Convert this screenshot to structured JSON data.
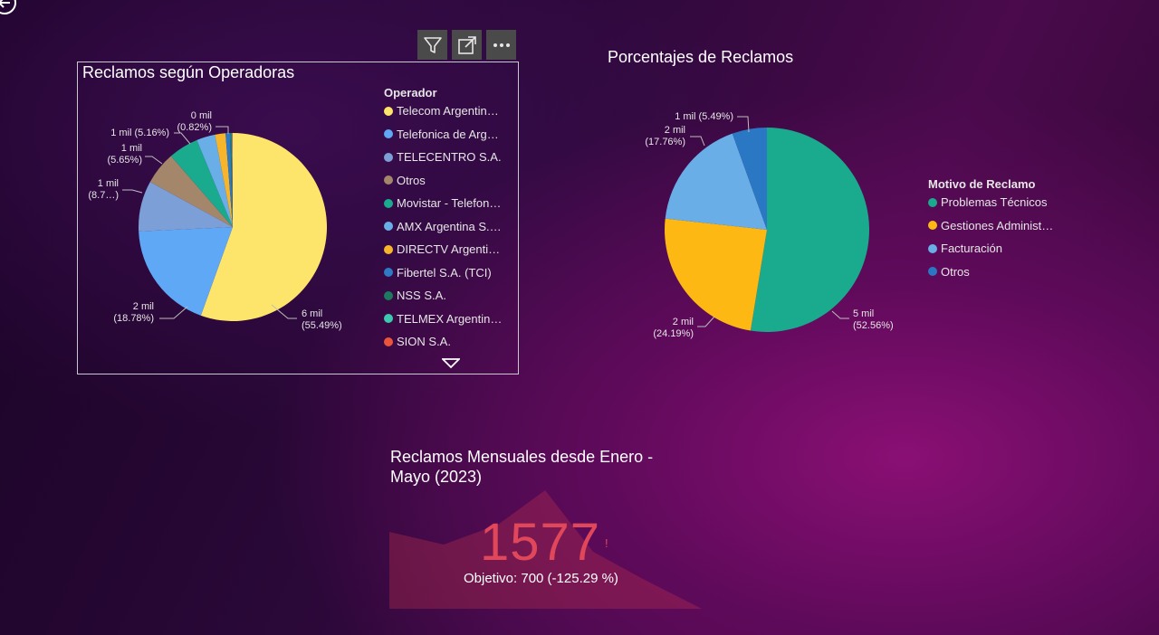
{
  "toolbar": {
    "icons": [
      "filter-icon",
      "focus-mode-icon",
      "more-options-icon"
    ]
  },
  "chart_data": [
    {
      "type": "pie",
      "title": "Reclamos según Operadoras",
      "legend_title": "Operador",
      "legend_placement": "right",
      "series": [
        {
          "name": "Telecom Argentin…",
          "value": 55.49,
          "color": "#fde46b"
        },
        {
          "name": "Telefonica de Arg…",
          "value": 18.78,
          "color": "#5ea8f5"
        },
        {
          "name": "TELECENTRO S.A.",
          "value": 8.7,
          "color": "#7b9fd6"
        },
        {
          "name": "Otros",
          "value": 5.65,
          "color": "#a4876b"
        },
        {
          "name": "Movistar - Telefon…",
          "value": 5.16,
          "color": "#1aaa8e"
        },
        {
          "name": "AMX Argentina S.…",
          "value": 3.2,
          "color": "#6aaee8"
        },
        {
          "name": "DIRECTV Argenti…",
          "value": 1.8,
          "color": "#f6b52a"
        },
        {
          "name": "Fibertel S.A. (TCI)",
          "value": 0.82,
          "color": "#2f7ac4"
        },
        {
          "name": "NSS S.A.",
          "value": 0.2,
          "color": "#1d7a5e"
        },
        {
          "name": "TELMEX Argentin…",
          "value": 0.1,
          "color": "#3cc9b0"
        },
        {
          "name": "SION S.A.",
          "value": 0.1,
          "color": "#e8553a"
        }
      ],
      "labels": [
        {
          "line1": "6 mil",
          "line2": "(55.49%)"
        },
        {
          "line1": "2 mil",
          "line2": "(18.78%)"
        },
        {
          "line1": "1 mil",
          "line2": "(8.7…)"
        },
        {
          "line1": "1 mil",
          "line2": "(5.65%)"
        },
        {
          "line1": "1 mil (5.16%)",
          "line2": ""
        },
        {
          "line1": "0 mil",
          "line2": "(0.82%)"
        }
      ]
    },
    {
      "type": "pie",
      "title": "Porcentajes de Reclamos",
      "legend_title": "Motivo de Reclamo",
      "legend_placement": "right",
      "series": [
        {
          "name": "Problemas Técnicos",
          "value": 52.56,
          "color": "#1aaa8e"
        },
        {
          "name": "Gestiones Administ…",
          "value": 24.19,
          "color": "#fdb814"
        },
        {
          "name": "Facturación",
          "value": 17.76,
          "color": "#6aaee8"
        },
        {
          "name": "Otros",
          "value": 5.49,
          "color": "#2a78c4"
        }
      ],
      "labels": [
        {
          "line1": "5 mil",
          "line2": "(52.56%)"
        },
        {
          "line1": "2 mil",
          "line2": "(24.19%)"
        },
        {
          "line1": "2 mil",
          "line2": "(17.76%)"
        },
        {
          "line1": "1 mil (5.49%)",
          "line2": ""
        }
      ]
    }
  ],
  "kpi": {
    "title": "Reclamos Mensuales desde Enero - Mayo (2023)",
    "value": "1577",
    "status_mark": "!",
    "goal_text": "Objetivo: 700 (-125.29 %)",
    "color": "#e0475a"
  }
}
